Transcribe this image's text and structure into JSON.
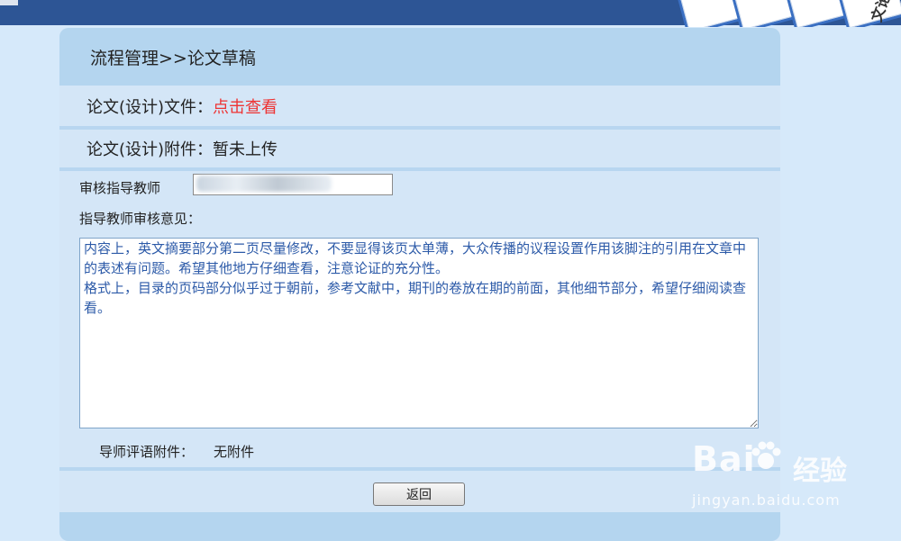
{
  "header": {
    "title": "流程管理>>论文草稿"
  },
  "banner": {
    "text": "文论"
  },
  "file_row": {
    "label": "论文(设计)文件：",
    "link": "点击查看"
  },
  "attachment_row": {
    "label": "论文(设计)附件：",
    "value": "暂未上传"
  },
  "teacher": {
    "label": "审核指导教师",
    "value": ""
  },
  "opinion": {
    "label": "指导教师审核意见：",
    "text": "内容上，英文摘要部分第二页尽量修改，不要显得该页太单薄，大众传播的议程设置作用该脚注的引用在文章中的表述有问题。希望其他地方仔细查看，注意论证的充分性。\n格式上，目录的页码部分似乎过于朝前，参考文献中，期刊的卷放在期的前面，其他细节部分，希望仔细阅读查看。"
  },
  "comment_attachment": {
    "label": "导师评语附件：",
    "value": "无附件"
  },
  "buttons": {
    "back": "返回"
  },
  "watermark": {
    "main": "Bai",
    "cn": "经验",
    "url": "jingyan.baidu.com"
  },
  "colors": {
    "topbar": "#2d5595",
    "link": "#ee3333",
    "opinion_text": "#2c5aa8"
  }
}
